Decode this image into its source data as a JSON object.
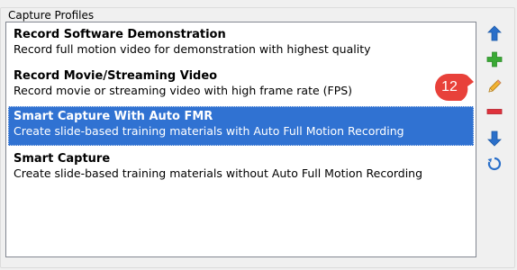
{
  "group": {
    "title": "Capture Profiles"
  },
  "profiles": [
    {
      "title": "Record Software Demonstration",
      "description": "Record full motion video for demonstration with highest quality",
      "selected": false
    },
    {
      "title": "Record Movie/Streaming Video",
      "description": "Record movie or streaming video with high frame rate (FPS)",
      "selected": false
    },
    {
      "title": "Smart Capture With Auto FMR",
      "description": "Create slide-based training materials with Auto Full Motion Recording",
      "selected": true
    },
    {
      "title": "Smart Capture",
      "description": "Create slide-based training materials without Auto Full Motion Recording",
      "selected": false
    }
  ],
  "toolbar": {
    "buttons": [
      {
        "name": "move-up-button",
        "icon": "arrow-up-icon"
      },
      {
        "name": "add-button",
        "icon": "plus-icon"
      },
      {
        "name": "edit-button",
        "icon": "pencil-icon"
      },
      {
        "name": "delete-button",
        "icon": "minus-icon"
      },
      {
        "name": "move-down-button",
        "icon": "arrow-down-icon"
      },
      {
        "name": "reset-button",
        "icon": "refresh-icon"
      }
    ]
  },
  "callout": {
    "label": "12",
    "color": "#e8413a"
  },
  "colors": {
    "selection": "#3072d2",
    "arrow_blue": "#2a6fc9",
    "add_green": "#3aa935",
    "delete_red": "#e0323c"
  }
}
